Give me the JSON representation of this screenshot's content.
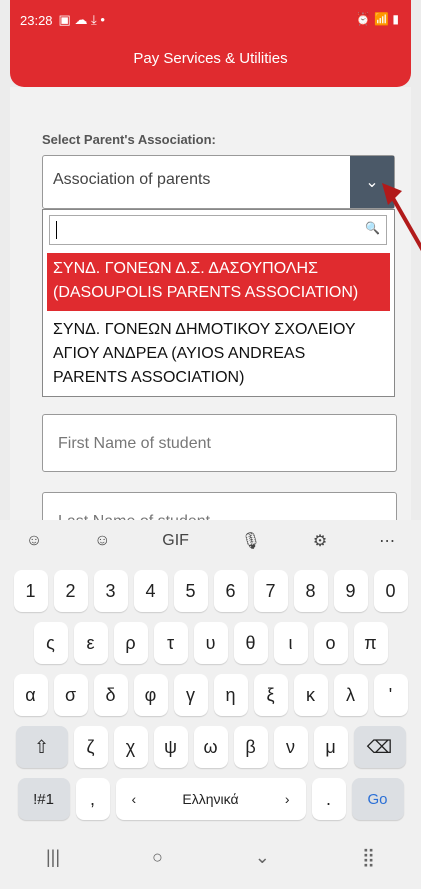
{
  "status": {
    "time": "23:28",
    "left_icons": "▣ ☁ ⤓ •",
    "right_icons": "⏰ 📶 ▮"
  },
  "header": {
    "title": "Pay Services & Utilities"
  },
  "form": {
    "label": "Select Parent's Association:",
    "select_value": "Association of parents",
    "options": [
      {
        "label": "ΣΥΝΔ. ΓΟΝΕΩΝ Δ.Σ. ΔΑΣΟΥΠΟΛΗΣ (DASOUPOLIS PARENTS ASSOCIATION)"
      },
      {
        "label": "ΣΥΝΔ. ΓΟΝΕΩΝ ΔΗΜΟΤΙΚΟΥ ΣΧΟΛΕΙΟΥ ΑΓΙΟΥ ΑΝΔΡΕΑ (AYIOS ANDREAS PARENTS ASSOCIATION)"
      }
    ],
    "first_name_placeholder": "First Name of student",
    "last_name_placeholder": "Last Name of student"
  },
  "keyboard": {
    "toolbar": [
      "☺",
      "☺",
      "GIF",
      "🎙",
      "⚙",
      "⋯"
    ],
    "row1": [
      "1",
      "2",
      "3",
      "4",
      "5",
      "6",
      "7",
      "8",
      "9",
      "0"
    ],
    "row2": [
      "ς",
      "ε",
      "ρ",
      "τ",
      "υ",
      "θ",
      "ι",
      "ο",
      "π"
    ],
    "row3": [
      "α",
      "σ",
      "δ",
      "φ",
      "γ",
      "η",
      "ξ",
      "κ",
      "λ",
      "ʹ"
    ],
    "row4": [
      "⇧",
      "ζ",
      "χ",
      "ψ",
      "ω",
      "β",
      "ν",
      "μ",
      "⌫"
    ],
    "row5": [
      "!#1",
      ",",
      "‹",
      "Ελληνικά",
      "›",
      ".",
      "Go"
    ],
    "nav": [
      "|||",
      "○",
      "⌄",
      "⣿"
    ]
  }
}
